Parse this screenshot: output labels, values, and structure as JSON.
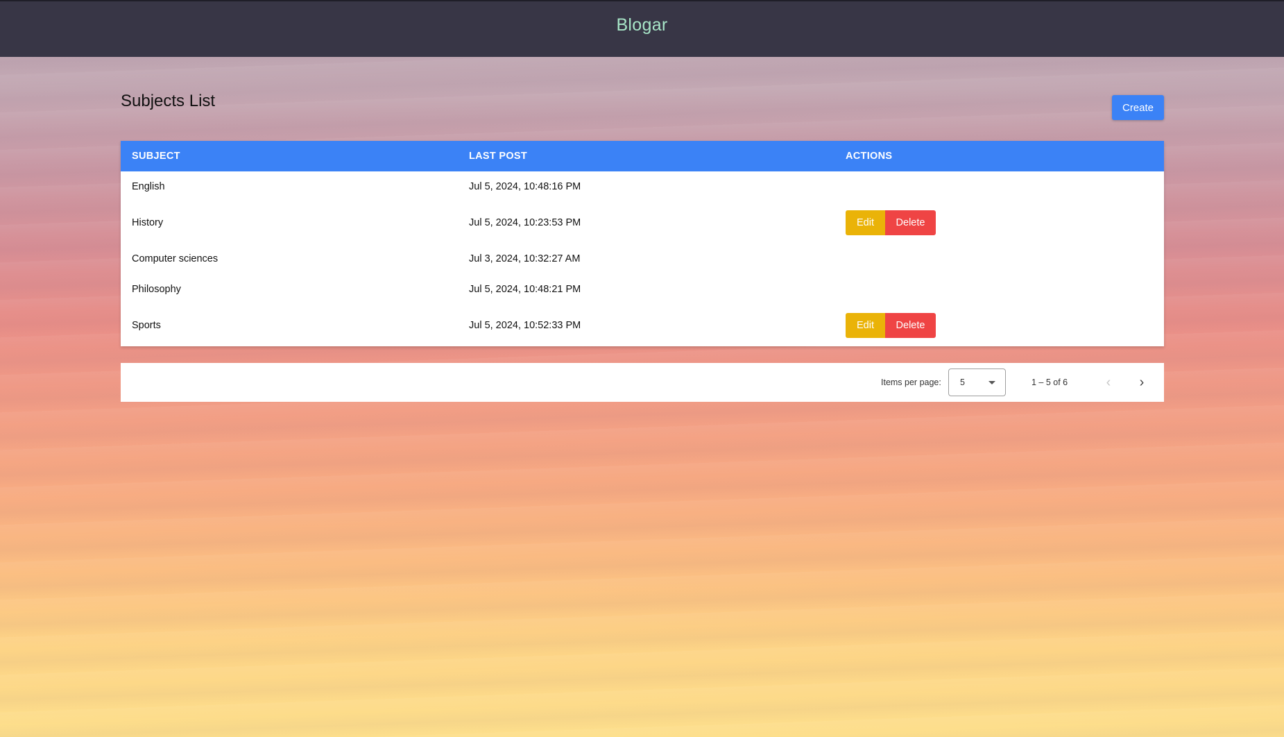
{
  "header": {
    "brand": "Blogar"
  },
  "page": {
    "title": "Subjects List",
    "create_label": "Create"
  },
  "table": {
    "columns": [
      "SUBJECT",
      "LAST POST",
      "ACTIONS"
    ],
    "rows": [
      {
        "subject": "English",
        "last_post": "Jul 5, 2024, 10:48:16 PM",
        "actions": false
      },
      {
        "subject": "History",
        "last_post": "Jul 5, 2024, 10:23:53 PM",
        "actions": true
      },
      {
        "subject": "Computer sciences",
        "last_post": "Jul 3, 2024, 10:32:27 AM",
        "actions": false
      },
      {
        "subject": "Philosophy",
        "last_post": "Jul 5, 2024, 10:48:21 PM",
        "actions": false
      },
      {
        "subject": "Sports",
        "last_post": "Jul 5, 2024, 10:52:33 PM",
        "actions": true
      }
    ],
    "edit_label": "Edit",
    "delete_label": "Delete"
  },
  "paginator": {
    "items_per_page_label": "Items per page:",
    "items_per_page_value": "5",
    "range_label": "1 – 5 of 6",
    "prev_icon": "chevron-left-icon",
    "next_icon": "chevron-right-icon"
  },
  "colors": {
    "header_bg": "#383646",
    "brand": "#a8e6c8",
    "primary": "#3b82f6",
    "edit": "#eab308",
    "delete": "#ef4444"
  }
}
